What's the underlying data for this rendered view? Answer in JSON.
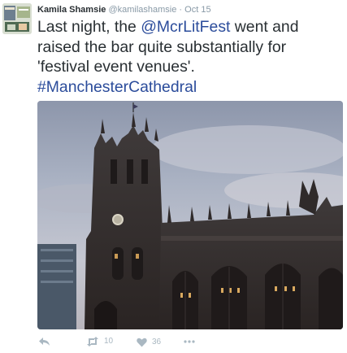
{
  "tweet": {
    "author_name": "Kamila Shamsie",
    "author_handle": "@kamilashamsie",
    "separator": "·",
    "date": "Oct 15",
    "text_part1": "Last night, the ",
    "mention": "@McrLitFest",
    "text_part2": " went and raised the bar quite substantially for 'festival event venues'.",
    "hashtag": "#ManchesterCathedral"
  },
  "actions": {
    "reply_icon": "reply-arrow-icon",
    "retweet_icon": "retweet-icon",
    "retweet_count": "10",
    "like_icon": "heart-icon",
    "like_count": "36",
    "more_icon": "ellipsis-icon"
  },
  "colors": {
    "link": "#2b4c9b",
    "muted": "#8899a6",
    "action_gray": "#aab8c2"
  }
}
